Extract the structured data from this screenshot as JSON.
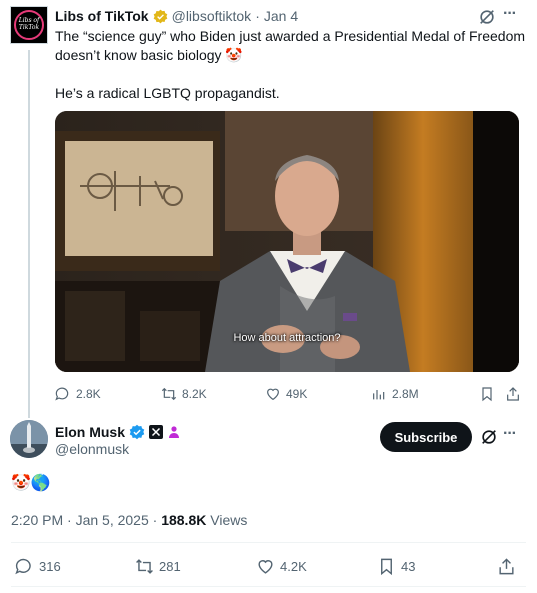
{
  "parent_tweet": {
    "avatar_text": "Libs of TikTok",
    "name": "Libs of TikTok",
    "handle": "@libsoftiktok",
    "separator": "·",
    "time": "Jan 4",
    "text_line1": "The “science guy” who Biden just awarded a Presidential Medal of Freedom doesn’t know basic biology 🤡",
    "text_line2": "He’s a radical LGBTQ propagandist.",
    "video_caption": "How about attraction?",
    "actions": {
      "replies": "2.8K",
      "reposts": "8.2K",
      "likes": "49K",
      "views": "2.8M"
    }
  },
  "main_tweet": {
    "name": "Elon Musk",
    "handle": "@elonmusk",
    "subscribe_label": "Subscribe",
    "more_label": "···",
    "emoji_text": "🤡🌎",
    "timestamp": "2:20 PM · Jan 5, 2025 · ",
    "views_count": "188.8K",
    "views_label": " Views",
    "actions": {
      "replies": "316",
      "reposts": "281",
      "likes": "4.2K",
      "bookmarks": "43"
    }
  },
  "colors": {
    "text": "#0f1419",
    "secondary": "#536471",
    "verified_blue": "#1d9bf0",
    "verified_gold": "#e2b719",
    "divider": "#eff3f4"
  }
}
